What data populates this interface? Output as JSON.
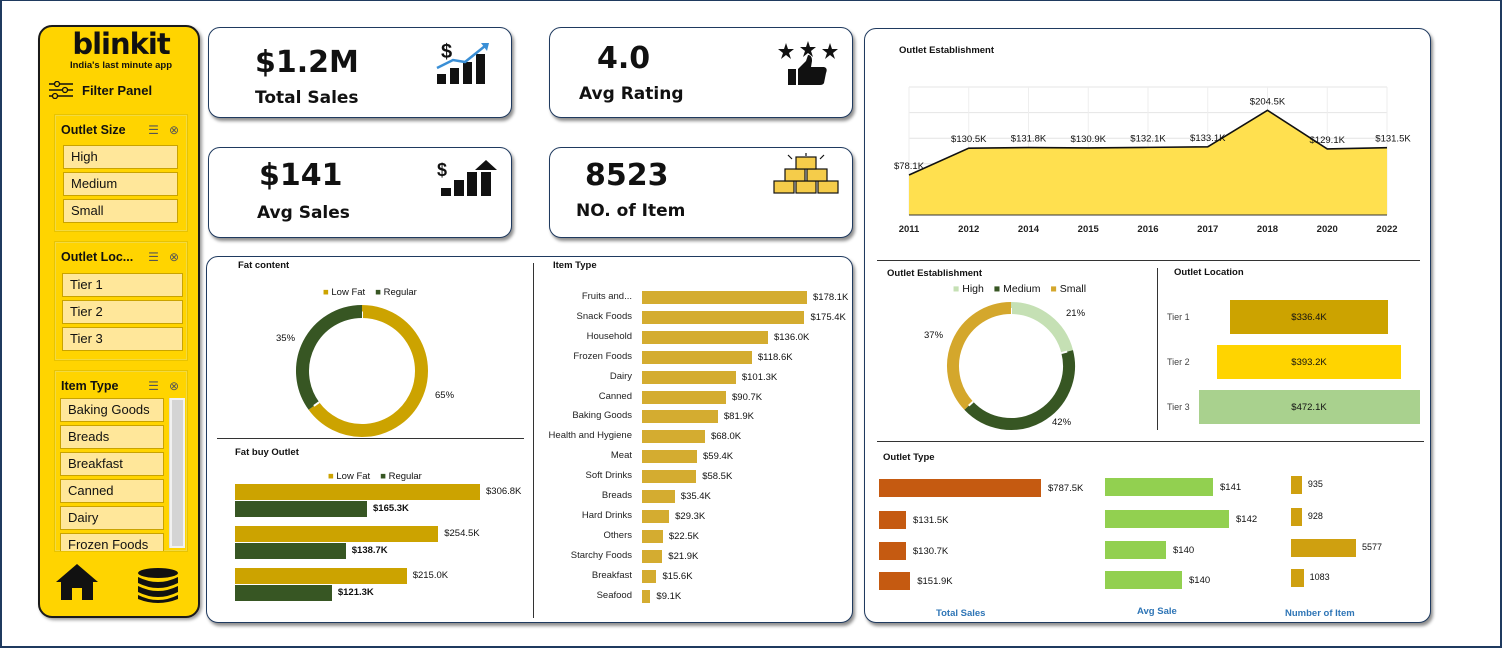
{
  "brand": {
    "logo": "blinkit",
    "tagline": "India's last minute app"
  },
  "filter_panel": {
    "title_prefix": "Filter ",
    "title_bold": "Panel",
    "slicers": [
      {
        "title": "Outlet Size",
        "items": [
          "High",
          "Medium",
          "Small"
        ]
      },
      {
        "title": "Outlet Loc...",
        "items": [
          "Tier 1",
          "Tier 2",
          "Tier 3"
        ]
      },
      {
        "title": "Item Type",
        "items": [
          "Baking Goods",
          "Breads",
          "Breakfast",
          "Canned",
          "Dairy",
          "Frozen Foods"
        ]
      }
    ],
    "nav": {
      "home_icon": "home-icon",
      "data_icon": "database-icon"
    }
  },
  "kpis": {
    "total_sales": {
      "value": "$1.2M",
      "label": "Total Sales",
      "icon": "sales-growth-icon"
    },
    "avg_rating": {
      "value": "4.0",
      "label": "Avg Rating",
      "icon": "stars-thumbs-up-icon"
    },
    "avg_sales": {
      "value": "$141",
      "label": "Avg  Sales",
      "icon": "dollar-bars-icon"
    },
    "no_items": {
      "value": "8523",
      "label": "NO. of Item",
      "icon": "boxes-icon"
    }
  },
  "colors": {
    "gold": "#cca300",
    "yellow": "#ffd400",
    "dark_green": "#375623",
    "light_green": "#a9d18e",
    "pale_green": "#c5e0b4",
    "orange": "#c55a11",
    "lime": "#92d050",
    "area_fill": "#ffe04f"
  },
  "chart_data": [
    {
      "type": "area",
      "title": "Outlet Establishment",
      "x": [
        "2011",
        "2012",
        "2014",
        "2015",
        "2016",
        "2017",
        "2018",
        "2020",
        "2022"
      ],
      "values": [
        78.1,
        130.5,
        131.8,
        130.9,
        132.1,
        133.1,
        204.5,
        129.1,
        131.5
      ],
      "labels": [
        "$78.1K",
        "$130.5K",
        "$131.8K",
        "$130.9K",
        "$132.1K",
        "$133.1K",
        "$204.5K",
        "$129.1K",
        "$131.5K"
      ],
      "ylim": [
        0,
        250
      ],
      "grid": true
    },
    {
      "type": "pie",
      "title": "Fat content",
      "legend": [
        "Low Fat",
        "Regular"
      ],
      "values": [
        65,
        35
      ],
      "labels": [
        "65%",
        "35%"
      ]
    },
    {
      "type": "bar",
      "title": "Fat buy Outlet",
      "legend": [
        "Low Fat",
        "Regular"
      ],
      "series": [
        {
          "name": "Low Fat",
          "values": [
            306.8,
            254.5,
            215.0
          ],
          "labels": [
            "$306.8K",
            "$254.5K",
            "$215.0K"
          ]
        },
        {
          "name": "Regular",
          "values": [
            165.3,
            138.7,
            121.3
          ],
          "labels": [
            "$165.3K",
            "$138.7K",
            "$121.3K"
          ]
        }
      ]
    },
    {
      "type": "bar",
      "title": "Item Type",
      "categories": [
        "Fruits and...",
        "Snack Foods",
        "Household",
        "Frozen Foods",
        "Dairy",
        "Canned",
        "Baking Goods",
        "Health and Hygiene",
        "Meat",
        "Soft Drinks",
        "Breads",
        "Hard Drinks",
        "Others",
        "Starchy Foods",
        "Breakfast",
        "Seafood"
      ],
      "values": [
        178.1,
        175.4,
        136.0,
        118.6,
        101.3,
        90.7,
        81.9,
        68.0,
        59.4,
        58.5,
        35.4,
        29.3,
        22.5,
        21.9,
        15.6,
        9.1
      ],
      "labels": [
        "$178.1K",
        "$175.4K",
        "$136.0K",
        "$118.6K",
        "$101.3K",
        "$90.7K",
        "$81.9K",
        "$68.0K",
        "$59.4K",
        "$58.5K",
        "$35.4K",
        "$29.3K",
        "$22.5K",
        "$21.9K",
        "$15.6K",
        "$9.1K"
      ]
    },
    {
      "type": "pie",
      "title": "Outlet Establishment",
      "legend": [
        "High",
        "Medium",
        "Small"
      ],
      "values": [
        21,
        42,
        37
      ],
      "labels": [
        "21%",
        "42%",
        "37%"
      ]
    },
    {
      "type": "bar",
      "title": "Outlet Location",
      "categories": [
        "Tier 1",
        "Tier 2",
        "Tier 3"
      ],
      "values": [
        336.4,
        393.2,
        472.1
      ],
      "labels": [
        "$336.4K",
        "$393.2K",
        "$472.1K"
      ]
    },
    {
      "type": "table",
      "title": "Outlet Type",
      "columns": [
        "Total Sales",
        "Avg Sale",
        "Number of Item"
      ],
      "total_sales": {
        "values": [
          787.5,
          131.5,
          130.7,
          151.9
        ],
        "labels": [
          "$787.5K",
          "$131.5K",
          "$130.7K",
          "$151.9K"
        ]
      },
      "avg_sale": {
        "values": [
          141,
          142,
          140,
          140
        ],
        "labels": [
          "$141",
          "$142",
          "$140",
          "$140"
        ]
      },
      "num_items": {
        "values": [
          935,
          928,
          5577,
          1083
        ],
        "labels": [
          "935",
          "928",
          "5577",
          "1083"
        ]
      }
    }
  ]
}
